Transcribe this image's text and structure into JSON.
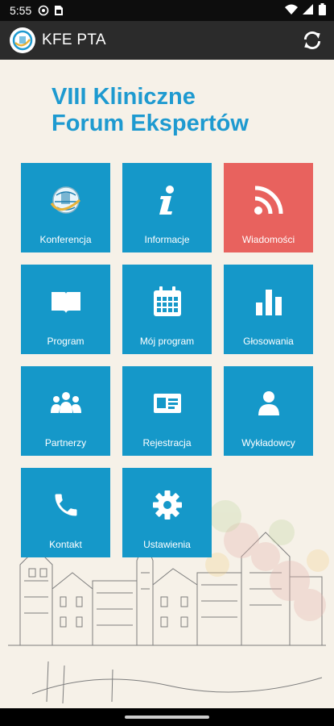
{
  "status_bar": {
    "time": "5:55"
  },
  "app_bar": {
    "title": "KFE PTA"
  },
  "heading": {
    "line1": "VIII Kliniczne",
    "line2": "Forum Ekspertów"
  },
  "tiles": [
    {
      "label": "Konferencja",
      "icon": "globe-logo-icon"
    },
    {
      "label": "Informacje",
      "icon": "info-icon"
    },
    {
      "label": "Wiadomości",
      "icon": "rss-icon"
    },
    {
      "label": "Program",
      "icon": "book-icon"
    },
    {
      "label": "Mój program",
      "icon": "calendar-icon"
    },
    {
      "label": "Głosowania",
      "icon": "bar-chart-icon"
    },
    {
      "label": "Partnerzy",
      "icon": "people-icon"
    },
    {
      "label": "Rejestracja",
      "icon": "id-card-icon"
    },
    {
      "label": "Wykładowcy",
      "icon": "person-icon"
    },
    {
      "label": "Kontakt",
      "icon": "phone-icon"
    },
    {
      "label": "Ustawienia",
      "icon": "gear-icon"
    }
  ],
  "colors": {
    "tile_blue": "#1598c9",
    "tile_red": "#e8625e",
    "heading_blue": "#1e9ad0",
    "background": "#f6f1e8",
    "app_bar": "#2b2b2b"
  }
}
